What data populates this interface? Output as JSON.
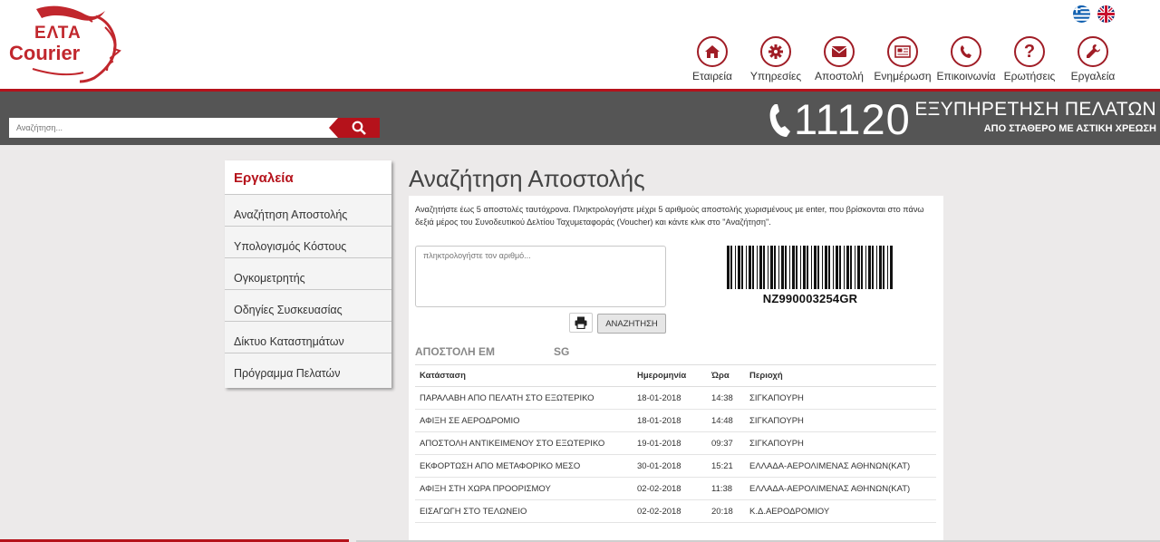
{
  "header": {
    "logo": {
      "line1": "ΕΛΤΑ",
      "line2": "Courier"
    },
    "languages": [
      {
        "name": "greek-flag-icon"
      },
      {
        "name": "uk-flag-icon"
      }
    ],
    "nav": [
      {
        "label": "Εταιρεία",
        "icon": "home-icon"
      },
      {
        "label": "Υπηρεσίες",
        "icon": "gear-icon"
      },
      {
        "label": "Αποστολή",
        "icon": "envelope-icon"
      },
      {
        "label": "Ενημέρωση",
        "icon": "newspaper-icon"
      },
      {
        "label": "Επικοινωνία",
        "icon": "phone-icon"
      },
      {
        "label": "Ερωτήσεις",
        "icon": "question-icon"
      },
      {
        "label": "Εργαλεία",
        "icon": "wrench-icon"
      }
    ]
  },
  "search": {
    "placeholder": "Αναζήτηση..."
  },
  "customer_service": {
    "phone": "11120",
    "title": "ΕΞΥΠΗΡΕΤΗΣΗ ΠΕΛΑΤΩΝ",
    "subtitle": "ΑΠΟ ΣΤΑΘΕΡΟ ΜΕ ΑΣΤΙΚΗ ΧΡΕΩΣΗ"
  },
  "sidebar": {
    "title": "Εργαλεία",
    "items": [
      {
        "label": "Αναζήτηση Αποστολής"
      },
      {
        "label": "Υπολογισμός Κόστους"
      },
      {
        "label": "Ογκομετρητής"
      },
      {
        "label": "Οδηγίες Συσκευασίας"
      },
      {
        "label": "Δίκτυο Καταστημάτων"
      },
      {
        "label": "Πρόγραμμα Πελατών"
      }
    ]
  },
  "main": {
    "title": "Αναζήτηση Αποστολής",
    "intro": "Αναζητήστε έως 5 αποστολές ταυτόχρονα. Πληκτρολογήστε μέχρι 5 αριθμούς αποστολής χωρισμένους με enter, που βρίσκονται στο πάνω δεξιά μέρος του Συνοδευτικού Δελτίου Ταχυμεταφοράς (Voucher) και κάντε κλικ στο \"Αναζήτηση\".",
    "input_placeholder": "πληκτρολογήστε τον αριθμό...",
    "search_button": "ΑΝΑΖΗΤΗΣΗ",
    "barcode": "NZ990003254GR",
    "shipment_label": "ΑΠΟΣΤΟΛΗ ΕΜ",
    "shipment_code": "SG",
    "table": {
      "headers": [
        "Κατάσταση",
        "Ημερομηνία",
        "Ώρα",
        "Περιοχή"
      ],
      "rows": [
        [
          "ΠΑΡΑΛΑΒΗ ΑΠΟ ΠΕΛΑΤΗ ΣΤΟ ΕΞΩΤΕΡΙΚΟ",
          "18-01-2018",
          "14:38",
          "ΣΙΓΚΑΠΟΥΡΗ"
        ],
        [
          "ΑΦΙΞΗ ΣΕ ΑΕΡΟΔΡΟΜΙΟ",
          "18-01-2018",
          "14:48",
          "ΣΙΓΚΑΠΟΥΡΗ"
        ],
        [
          "ΑΠΟΣΤΟΛΗ ΑΝΤΙΚΕΙΜΕΝΟΥ ΣΤΟ ΕΞΩΤΕΡΙΚΟ",
          "19-01-2018",
          "09:37",
          "ΣΙΓΚΑΠΟΥΡΗ"
        ],
        [
          "ΕΚΦΟΡΤΩΣΗ ΑΠΟ ΜΕΤΑΦΟΡΙΚΟ ΜΕΣΟ",
          "30-01-2018",
          "15:21",
          "ΕΛΛΑΔΑ-ΑΕΡΟΛΙΜΕΝΑΣ ΑΘΗΝΩΝ(ΚΑΤ)"
        ],
        [
          "ΑΦΙΞΗ ΣΤΗ ΧΩΡΑ ΠΡΟΟΡΙΣΜΟΥ",
          "02-02-2018",
          "11:38",
          "ΕΛΛΑΔΑ-ΑΕΡΟΛΙΜΕΝΑΣ ΑΘΗΝΩΝ(ΚΑΤ)"
        ],
        [
          "ΕΙΣΑΓΩΓΗ ΣΤΟ ΤΕΛΩΝΕΙΟ",
          "02-02-2018",
          "20:18",
          "Κ.Δ.ΑΕΡΟΔΡΟΜΙΟΥ"
        ]
      ]
    }
  },
  "colors": {
    "accent": "#b5121b",
    "bar": "#555555",
    "background": "#eceaea"
  }
}
